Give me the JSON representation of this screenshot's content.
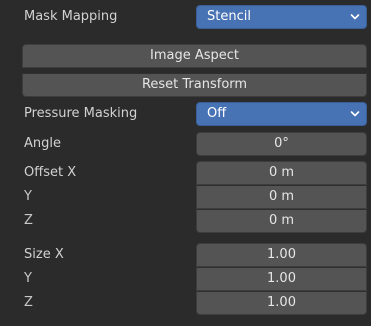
{
  "mask_mapping": {
    "label": "Mask Mapping",
    "value": "Stencil",
    "chevron_icon": "chevron-down-icon"
  },
  "buttons": {
    "image_aspect": "Image Aspect",
    "reset_transform": "Reset Transform"
  },
  "pressure_masking": {
    "label": "Pressure Masking",
    "value": "Off",
    "chevron_icon": "chevron-down-icon"
  },
  "angle": {
    "label": "Angle",
    "value": "0°"
  },
  "offset": {
    "x_label": "Offset X",
    "y_label": "Y",
    "z_label": "Z",
    "x_value": "0 m",
    "y_value": "0 m",
    "z_value": "0 m"
  },
  "size": {
    "x_label": "Size X",
    "y_label": "Y",
    "z_label": "Z",
    "x_value": "1.00",
    "y_value": "1.00",
    "z_value": "1.00"
  },
  "colors": {
    "background": "#2b2b2b",
    "field": "#545454",
    "accent": "#4772b3"
  }
}
